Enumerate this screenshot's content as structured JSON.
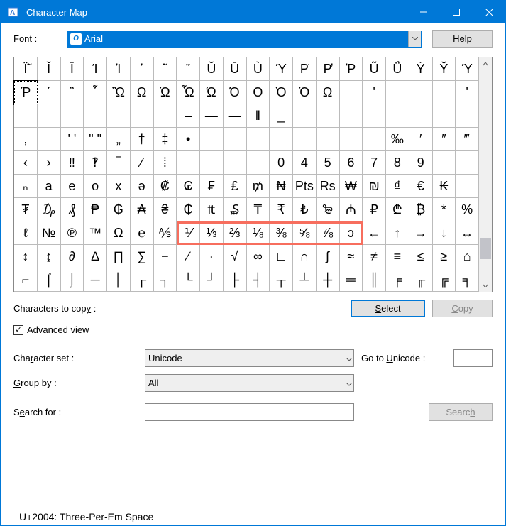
{
  "window": {
    "title": "Character Map"
  },
  "toolbar": {
    "font_label": "Font :",
    "font_value": "Arial",
    "help_label": "Help"
  },
  "grid": {
    "rows": [
      [
        "Ϊ̃",
        "Ǐ",
        "Ī",
        "Ί",
        "Ἰ",
        "᾿",
        "῀",
        "῎",
        "Ŭ",
        "Ū",
        "Ù",
        "Ύ",
        "Ρ̇",
        "Ρ̓",
        "Ῥ",
        "Ũ",
        "Ǘ",
        "Ý",
        "Ῠ",
        "Ύ"
      ],
      [
        "Ῥ",
        "῾",
        "῍",
        "῟",
        "Ὢ",
        "Ω",
        "Ὡ",
        "Ὦ",
        "Ώ",
        "Ό",
        "Ο",
        "Ὀ",
        "Ὁ",
        "Ω",
        " ",
        "'",
        " ",
        " ",
        " ",
        "'"
      ],
      [
        " ",
        " ",
        " ",
        " ",
        " ",
        " ",
        " ",
        "–",
        "—",
        "―",
        "‖",
        "_",
        " ",
        " ",
        " ",
        " ",
        " ",
        " ",
        " ",
        " "
      ],
      [
        ",",
        " ",
        "' '",
        "\" \"",
        "„",
        "†",
        "‡",
        "•",
        " ",
        " ",
        " ",
        " ",
        " ",
        " ",
        " ",
        " ",
        "‰",
        "′",
        "″",
        "‴"
      ],
      [
        "‹",
        "›",
        "‼",
        "‽",
        "‾",
        "⁄",
        "⁞",
        " ",
        " ",
        " ",
        " ",
        "0",
        "4",
        "5",
        "6",
        "7",
        "8",
        "9",
        " ",
        " "
      ],
      [
        "ₙ",
        "a",
        "e",
        "o",
        "x",
        "ə",
        "₡",
        "₢",
        "₣",
        "₤",
        "₥",
        "₦",
        "Pts",
        "Rs",
        "₩",
        "₪",
        "₫",
        "€",
        "₭",
        " "
      ],
      [
        "₮",
        "₯",
        "₰",
        "₱",
        "₲",
        "₳",
        "₴",
        "₵",
        "₶",
        "₷",
        "₸",
        "₹",
        "₺",
        "₻",
        "₼",
        "₽",
        "₾",
        "₿",
        "*",
        "%"
      ],
      [
        "ℓ",
        "№",
        "℗",
        "™",
        "Ω",
        "℮",
        "⅍",
        "⅟",
        "⅓",
        "⅔",
        "⅛",
        "⅜",
        "⅝",
        "⅞",
        "ↄ",
        "←",
        "↑",
        "→",
        "↓",
        "↔"
      ],
      [
        "↕",
        "↨",
        "∂",
        "∆",
        "∏",
        "∑",
        "−",
        "∕",
        "∙",
        "√",
        "∞",
        "∟",
        "∩",
        "∫",
        "≈",
        "≠",
        "≡",
        "≤",
        "≥",
        "⌂"
      ],
      [
        "⌐",
        "⌠",
        "⌡",
        "─",
        "│",
        "┌",
        "┐",
        "└",
        "┘",
        "├",
        "┤",
        "┬",
        "┴",
        "┼",
        "═",
        "║",
        "╒",
        "╓",
        "╔",
        "╕"
      ]
    ],
    "selected_row": 1,
    "selected_col": 0,
    "highlight": {
      "row": 7,
      "col_start": 7,
      "col_end": 14
    }
  },
  "controls": {
    "chars_to_copy_label": "Characters to copy :",
    "chars_to_copy_value": "",
    "select_label": "Select",
    "copy_label": "Copy",
    "advview_checked": true,
    "advview_label": "Advanced view",
    "charset_label": "Character set :",
    "charset_value": "Unicode",
    "goto_label": "Go to Unicode :",
    "goto_value": "",
    "groupby_label": "Group by :",
    "groupby_value": "All",
    "search_label": "Search for :",
    "search_value": "",
    "search_btn": "Search"
  },
  "status": "U+2004: Three-Per-Em Space"
}
